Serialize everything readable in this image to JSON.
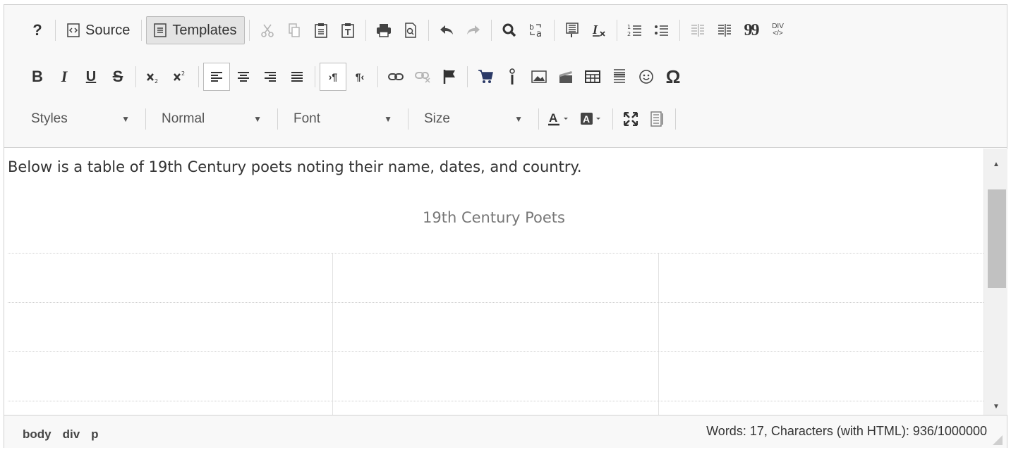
{
  "toolbar": {
    "source_label": "Source",
    "templates_label": "Templates",
    "help_label": "?",
    "bold_label": "B",
    "italic_label": "I",
    "underline_label": "U",
    "strike_label": "S",
    "omega_label": "Ω",
    "quote_label": "99",
    "div_label": "DIV",
    "styles_label": "Styles",
    "format_label": "Normal",
    "font_label": "Font",
    "size_label": "Size"
  },
  "content": {
    "intro_text": "Below is a table of 19th Century poets noting their name, dates, and country.",
    "table_caption": "19th Century Poets",
    "table_rows": [
      [
        "",
        "",
        ""
      ],
      [
        "",
        "",
        ""
      ],
      [
        "",
        "",
        ""
      ],
      [
        "",
        "",
        ""
      ]
    ]
  },
  "status": {
    "path": [
      "body",
      "div",
      "p"
    ],
    "counter": "Words: 17, Characters (with HTML): 936/1000000"
  },
  "colors": {
    "toolbar_bg": "#f8f8f8",
    "border": "#d1d1d1",
    "caption": "#777777",
    "cart_icon": "#2b3a67"
  }
}
